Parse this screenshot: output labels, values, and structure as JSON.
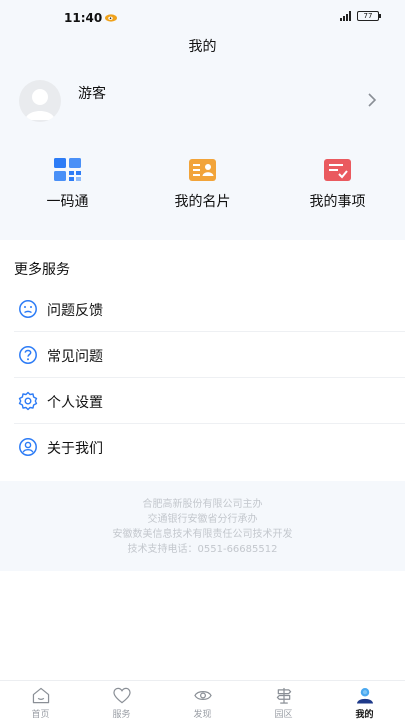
{
  "status_bar": {
    "time": "11:40",
    "battery": "77"
  },
  "header": {
    "title": "我的"
  },
  "profile": {
    "name": "游客"
  },
  "quick_actions": [
    {
      "label": "一码通",
      "icon": "qr-code-icon"
    },
    {
      "label": "我的名片",
      "icon": "business-card-icon"
    },
    {
      "label": "我的事项",
      "icon": "task-list-icon"
    }
  ],
  "services": {
    "title": "更多服务",
    "items": [
      {
        "label": "问题反馈",
        "icon": "feedback-face-icon"
      },
      {
        "label": "常见问题",
        "icon": "help-question-icon"
      },
      {
        "label": "个人设置",
        "icon": "settings-gear-icon"
      },
      {
        "label": "关于我们",
        "icon": "about-user-icon"
      }
    ]
  },
  "footer": {
    "lines": [
      "合肥高新股份有限公司主办",
      "交通银行安徽省分行承办",
      "安徽数美信息技术有限责任公司技术开发",
      "技术支持电话：0551-66685512"
    ]
  },
  "tab_bar": {
    "tabs": [
      {
        "label": "首页",
        "icon": "home-icon",
        "active": false
      },
      {
        "label": "服务",
        "icon": "heart-icon",
        "active": false
      },
      {
        "label": "发现",
        "icon": "eye-icon",
        "active": false
      },
      {
        "label": "园区",
        "icon": "signpost-icon",
        "active": false
      },
      {
        "label": "我的",
        "icon": "profile-icon",
        "active": true
      }
    ]
  },
  "colors": {
    "background_top": "#f5f8fc",
    "accent_blue": "#2d7cf6",
    "card_orange": "#f2a43a",
    "task_red": "#ea5a5f",
    "tab_inactive": "#9a9ea5"
  }
}
